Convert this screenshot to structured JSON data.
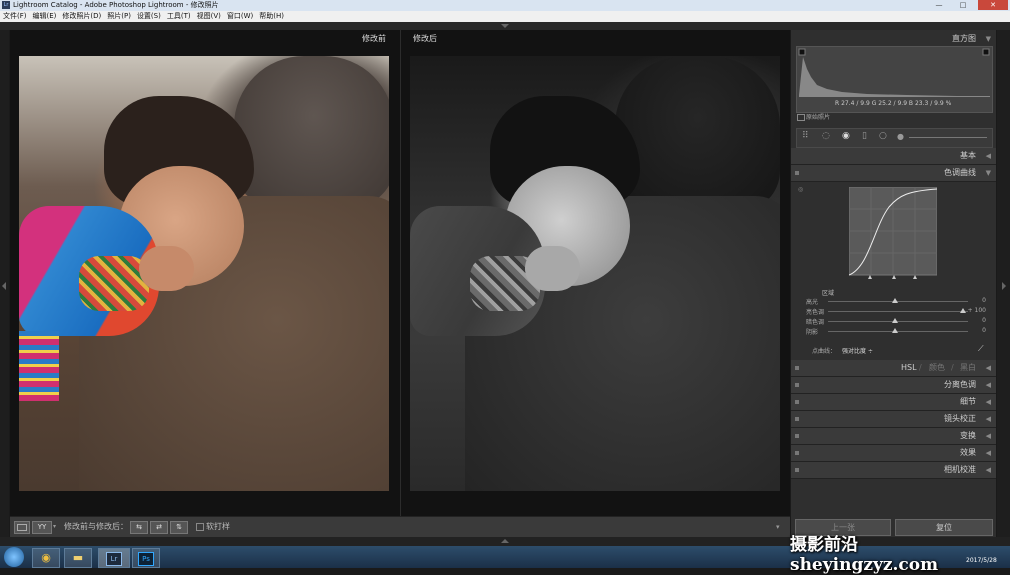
{
  "window": {
    "title": "Lightroom Catalog - Adobe Photoshop Lightroom - 修改照片",
    "app_icon": "Lr",
    "min": "—",
    "max": "□",
    "close": "✕"
  },
  "menu": [
    "文件(F)",
    "编辑(E)",
    "修改照片(D)",
    "照片(P)",
    "设置(S)",
    "工具(T)",
    "视图(V)",
    "窗口(W)",
    "帮助(H)"
  ],
  "view": {
    "before_label": "修改前",
    "after_label": "修改后"
  },
  "panel": {
    "histogram": {
      "title": "直方图",
      "readout": "R 27.4 / 9.9  G 25.2 / 9.9  B 23.3 / 9.9 %",
      "original_photo": "原始照片"
    },
    "basic": "基本",
    "tone_curve": {
      "title": "色调曲线",
      "region": "区域",
      "sliders": [
        {
          "name": "高光",
          "value": "0",
          "pos": 0.5
        },
        {
          "name": "亮色调",
          "value": "+ 100",
          "pos": 1.0
        },
        {
          "name": "暗色调",
          "value": "0",
          "pos": 0.5
        },
        {
          "name": "阴影",
          "value": "0",
          "pos": 0.5
        }
      ],
      "point_curve_label": "点曲线：",
      "point_curve_value": "强对比度 ÷"
    },
    "hsl": {
      "hsl": "HSL",
      "sep": "/",
      "color": "颜色",
      "bw": "黑白"
    },
    "sections": [
      "分离色调",
      "细节",
      "镜头校正",
      "变换",
      "效果",
      "相机校准"
    ],
    "prev_button": "上一张",
    "reset_button": "复位"
  },
  "toolbar": {
    "view_mode": "YY",
    "before_after": "修改前与修改后：",
    "soft_proof": "软打样"
  },
  "taskbar": {
    "apps": [
      "Lr",
      "Ps"
    ],
    "time": "",
    "date": "2017/5/28"
  },
  "watermark": "摄影前沿 sheyingzyz.com",
  "colors": {
    "panel_bg": "#2f2f2f",
    "header_bg": "#3a3a3a",
    "taskbar": "#1b3048",
    "close": "#c9483b"
  }
}
